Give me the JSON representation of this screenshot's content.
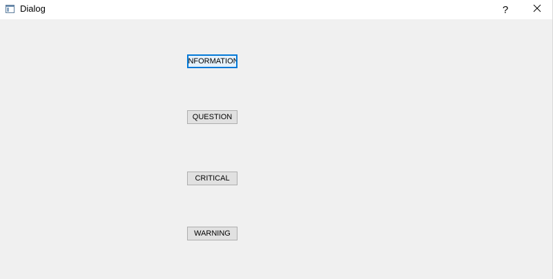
{
  "window": {
    "title": "Dialog",
    "help_label": "?",
    "app_icon": "dialog-window-icon",
    "help_icon": "question-mark-icon",
    "close_icon": "close-icon"
  },
  "buttons": [
    {
      "label": "INFORMATION",
      "focused": true
    },
    {
      "label": "QUESTION",
      "focused": false
    },
    {
      "label": "CRITICAL",
      "focused": false
    },
    {
      "label": "WARNING",
      "focused": false
    }
  ],
  "colors": {
    "focus_border": "#0078d7",
    "window_background": "#f0f0f0",
    "button_face": "#e1e1e1"
  }
}
